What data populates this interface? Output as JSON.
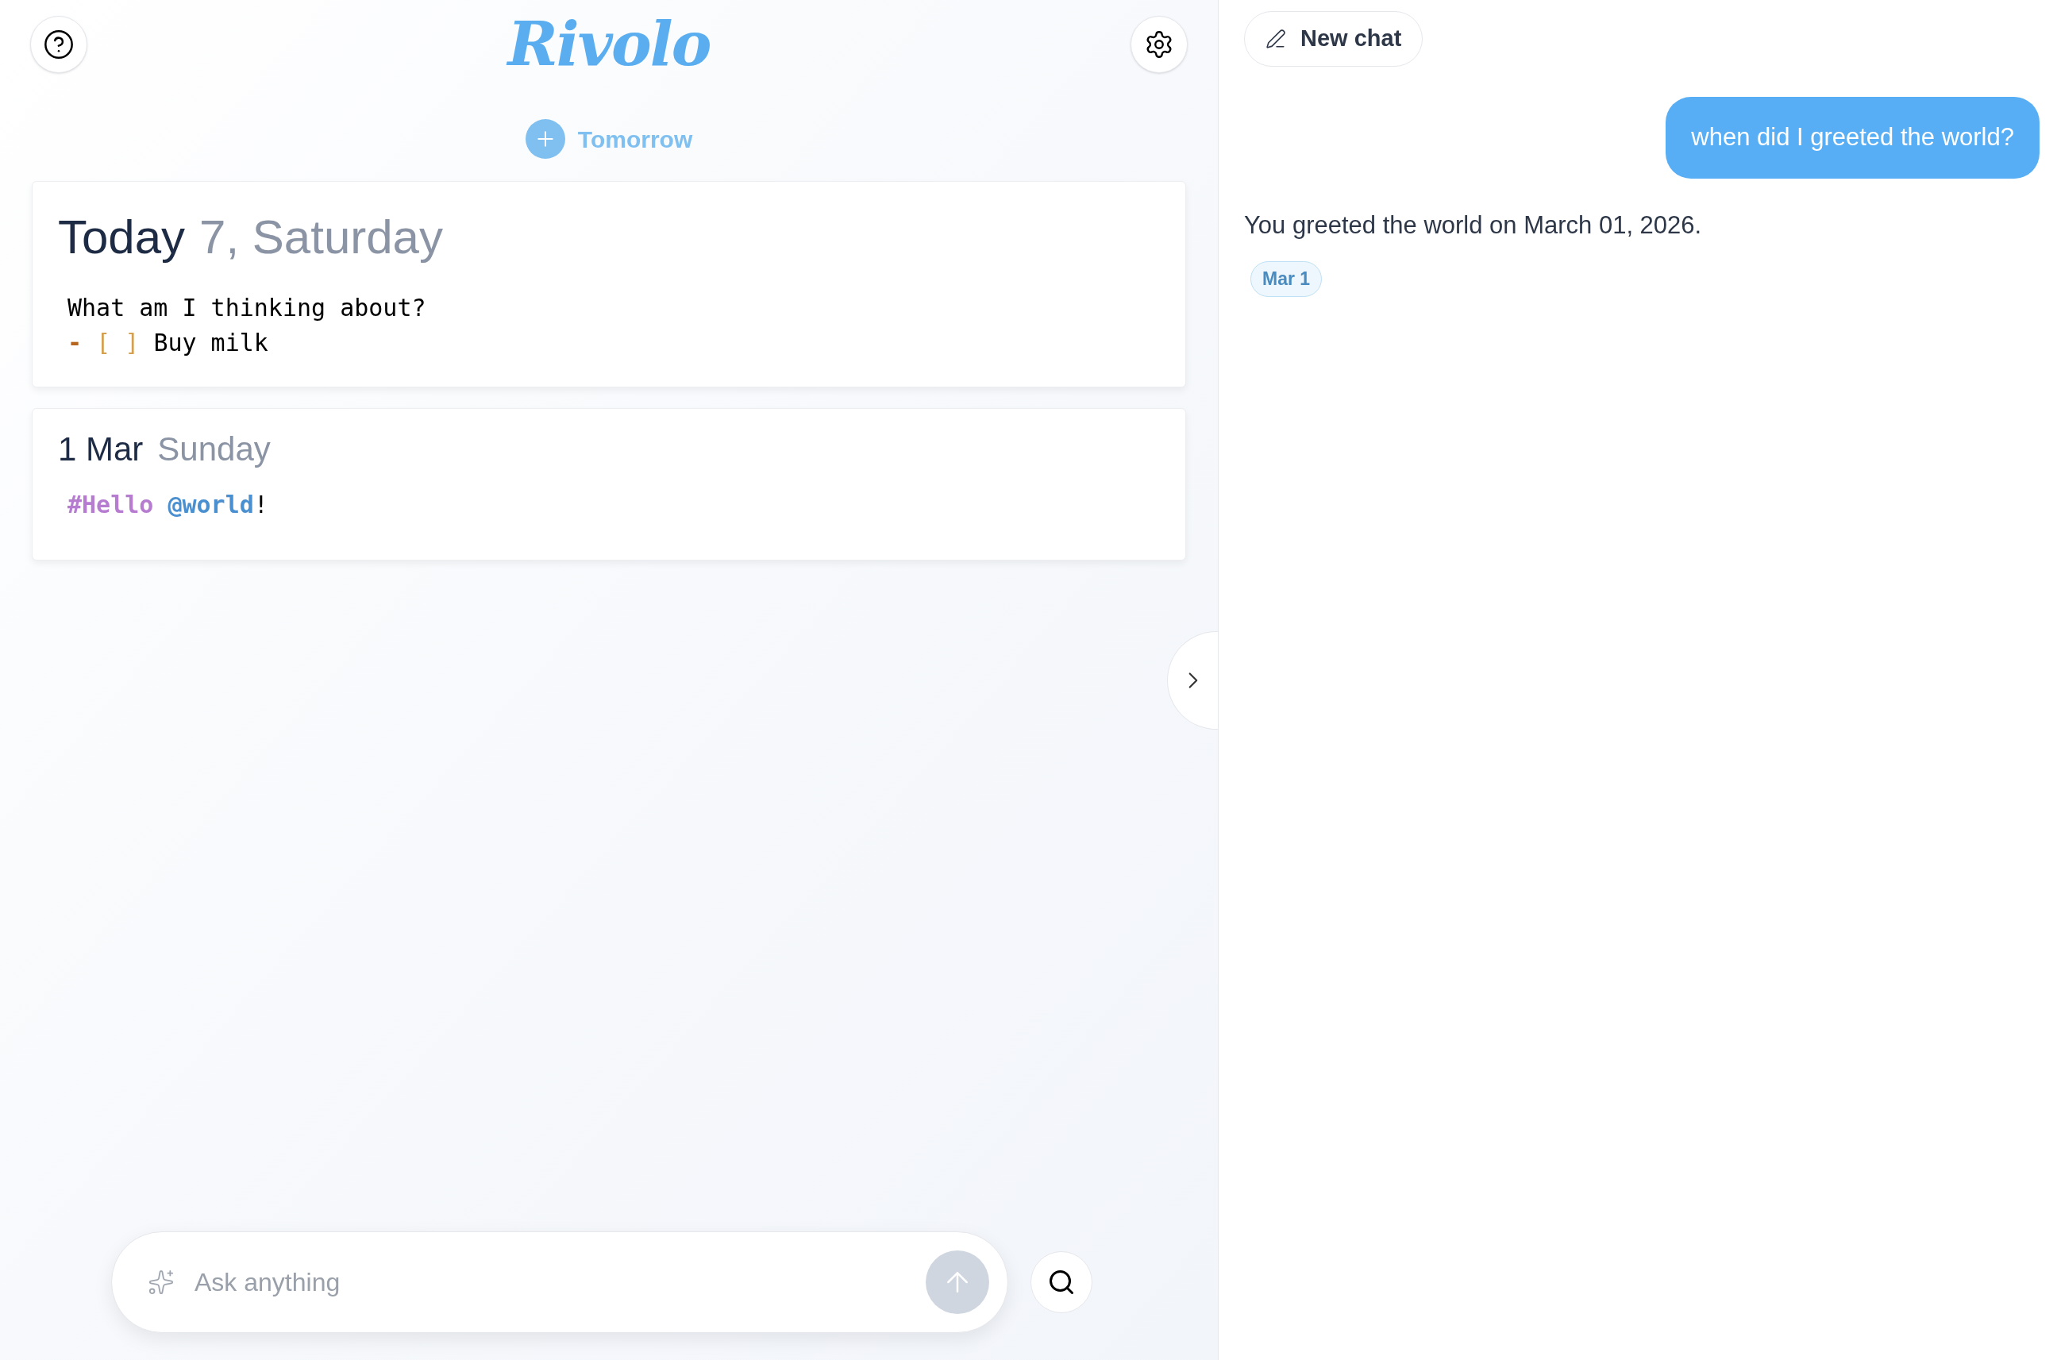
{
  "header": {
    "logo": "Rivolo"
  },
  "add_day": {
    "label": "Tomorrow"
  },
  "days": [
    {
      "title": "Today",
      "subtitle": "7, Saturday",
      "kind": "today",
      "lines": [
        [
          {
            "kind": "text",
            "text": "What am I thinking about?"
          }
        ],
        [
          {
            "kind": "dash",
            "text": "- "
          },
          {
            "kind": "checkbox",
            "text": "[ ] "
          },
          {
            "kind": "text",
            "text": "Buy milk"
          }
        ]
      ]
    },
    {
      "title": "1 Mar",
      "subtitle": "Sunday",
      "kind": "day",
      "lines": [
        [
          {
            "kind": "tag",
            "text": "#Hello "
          },
          {
            "kind": "mention",
            "text": "@world"
          },
          {
            "kind": "text",
            "text": "!"
          }
        ]
      ]
    }
  ],
  "ask": {
    "placeholder": "Ask anything"
  },
  "chat": {
    "new_chat": "New chat",
    "messages": [
      {
        "kind": "user",
        "text": "when did I greeted the world?"
      },
      {
        "kind": "assistant",
        "text": "You greeted the world on March 01, 2026.",
        "refs": [
          "Mar 1"
        ]
      }
    ]
  }
}
